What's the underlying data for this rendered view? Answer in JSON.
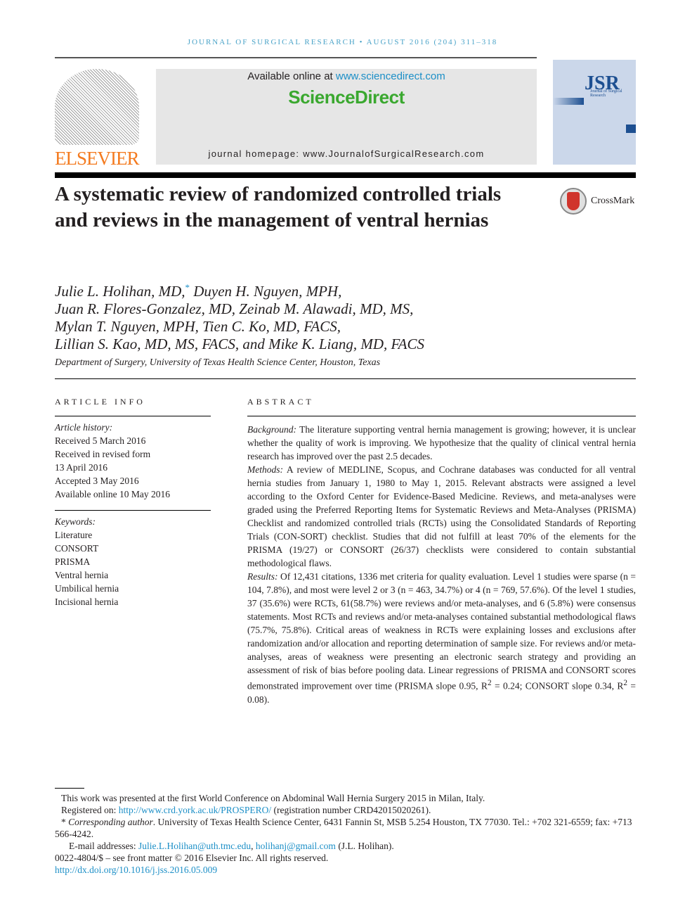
{
  "running_head": "JOURNAL OF SURGICAL RESEARCH • AUGUST 2016 (204) 311–318",
  "publisher_logo": "ELSEVIER",
  "banner": {
    "available_prefix": "Available online at ",
    "available_link": "www.sciencedirect.com",
    "brand": "ScienceDirect",
    "homepage": "journal homepage: www.JournalofSurgicalResearch.com"
  },
  "cover": {
    "title": "JSR",
    "subtitle": "Journal of Surgical Research"
  },
  "title": "A systematic review of randomized controlled trials and reviews in the management of ventral hernias",
  "crossmark": "CrossMark",
  "authors": [
    "Julie L. Holihan, MD,",
    "Duyen H. Nguyen, MPH,",
    "Juan R. Flores-Gonzalez, MD, Zeinab M. Alawadi, MD, MS,",
    "Mylan T. Nguyen, MPH, Tien C. Ko, MD, FACS,",
    "Lillian S. Kao, MD, MS, FACS, and Mike K. Liang, MD, FACS"
  ],
  "author_mark": "*",
  "affiliation": "Department of Surgery, University of Texas Health Science Center, Houston, Texas",
  "article_info": {
    "heading": "ARTICLE INFO",
    "history_label": "Article history:",
    "history": [
      "Received 5 March 2016",
      "Received in revised form",
      "13 April 2016",
      "Accepted 3 May 2016",
      "Available online 10 May 2016"
    ],
    "keywords_label": "Keywords:",
    "keywords": [
      "Literature",
      "CONSORT",
      "PRISMA",
      "Ventral hernia",
      "Umbilical hernia",
      "Incisional hernia"
    ]
  },
  "abstract": {
    "heading": "ABSTRACT",
    "background_label": "Background:",
    "background": " The literature supporting ventral hernia management is growing; however, it is unclear whether the quality of work is improving. We hypothesize that the quality of clinical ventral hernia research has improved over the past 2.5 decades.",
    "methods_label": "Methods:",
    "methods": " A review of MEDLINE, Scopus, and Cochrane databases was conducted for all ventral hernia studies from January 1, 1980 to May 1, 2015. Relevant abstracts were assigned a level according to the Oxford Center for Evidence-Based Medicine. Reviews, and meta-analyses were graded using the Preferred Reporting Items for Systematic Reviews and Meta-Analyses (PRISMA) Checklist and randomized controlled trials (RCTs) using the Consolidated Standards of Reporting Trials (CON-SORT) checklist. Studies that did not fulfill at least 70% of the elements for the PRISMA (19/27) or CONSORT (26/37) checklists were considered to contain substantial methodological flaws.",
    "results_label": "Results:",
    "results_parts": [
      " Of 12,431 citations, 1336 met criteria for quality evaluation. Level 1 studies were sparse (n = 104, 7.8%), and most were level 2 or 3 (n = 463, 34.7%) or 4 (n = 769, 57.6%). Of the level 1 studies, 37 (35.6%) were RCTs, 61(58.7%) were reviews and/or meta-analyses, and 6 (5.8%) were consensus statements. Most RCTs and reviews and/or meta-analyses contained substantial methodological flaws (75.7%, 75.8%). Critical areas of weakness in RCTs were explaining losses and exclusions after randomization and/or allocation and reporting determination of sample size. For reviews and/or meta-analyses, areas of weakness were presenting an electronic search strategy and providing an assessment of risk of bias before pooling data. Linear regressions of PRISMA and CONSORT scores demonstrated improvement over time (PRISMA slope 0.95, R",
      "2",
      " = 0.24; CONSORT slope 0.34, R",
      "2",
      " = 0.08)."
    ]
  },
  "footnotes": {
    "presented": "This work was presented at the first World Conference on Abdominal Wall Hernia Surgery 2015 in Milan, Italy.",
    "registered_prefix": "Registered on: ",
    "registered_link": "http://www.crd.york.ac.uk/PROSPERO/",
    "registered_suffix": " (registration number CRD42015020261).",
    "corr_mark": "* ",
    "corr_label": "Corresponding author",
    "corr_text": ". University of Texas Health Science Center, 6431 Fannin St, MSB 5.254 Houston, TX 77030. Tel.: +702 321-6559; fax: +713 566-4242.",
    "email_label": "E-mail addresses: ",
    "email1": "Julie.L.Holihan@uth.tmc.edu",
    "email_sep": ", ",
    "email2": "holihanj@gmail.com",
    "email_suffix": " (J.L. Holihan).",
    "copyright": "0022-4804/$ – see front matter © 2016 Elsevier Inc. All rights reserved.",
    "doi": "http://dx.doi.org/10.1016/j.jss.2016.05.009"
  }
}
